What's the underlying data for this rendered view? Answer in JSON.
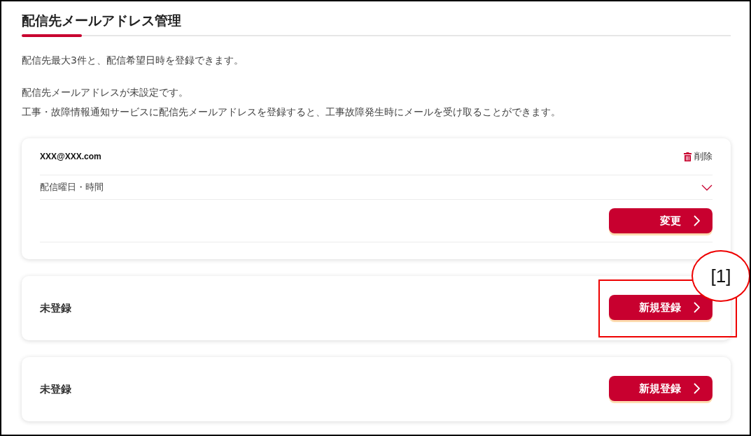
{
  "title": "配信先メールアドレス管理",
  "intro": "配信先最大3件と、配信希望日時を登録できます。",
  "notice": [
    "配信先メールアドレスが未設定です。",
    "工事・故障情報通知サービスに配信先メールアドレスを登録すると、工事故障発生時にメールを受け取ることができます。"
  ],
  "entries": [
    {
      "kind": "registered",
      "email": "XXX@XXX.com",
      "delete_label": "削除",
      "schedule_label": "配信曜日・時間",
      "button": "変更"
    },
    {
      "kind": "empty",
      "status": "未登録",
      "button": "新規登録"
    },
    {
      "kind": "empty",
      "status": "未登録",
      "button": "新規登録"
    }
  ],
  "annotation": {
    "label": "[1]"
  }
}
